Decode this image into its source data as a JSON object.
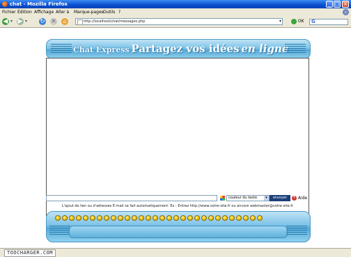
{
  "window": {
    "title": "chat - Mozilla Firefox",
    "buttons": [
      "_",
      "□",
      "X"
    ]
  },
  "menubar": {
    "items": [
      "Fichier",
      "Édition",
      "Affichage",
      "Aller à",
      "Marque-pages",
      "Outils",
      "?"
    ]
  },
  "navbar": {
    "url": "http://localhost/chat/messages.php",
    "go_label": "OK",
    "search_engine": "G"
  },
  "page": {
    "banner_small": "Chat Express",
    "banner_main": "Partagez vos idées",
    "banner_italic": "en ligne",
    "color_select_value": "couleur du texte",
    "send_label": "envoyer",
    "help_label": "Aide",
    "hint_text": "L'ajout de lien ou d'adresses E-mail se fait automatiquement. Ex : Entrez http://www.votre-site.fr ou encore webmaster@votre-site.fr",
    "smiley_count": 30
  },
  "status": {
    "watermark": "TOOCHARGER.COM"
  },
  "colors": {
    "titlebar": "#0a4fd0",
    "banner": "#7cc3e8",
    "send_button": "#1c3f7a"
  }
}
